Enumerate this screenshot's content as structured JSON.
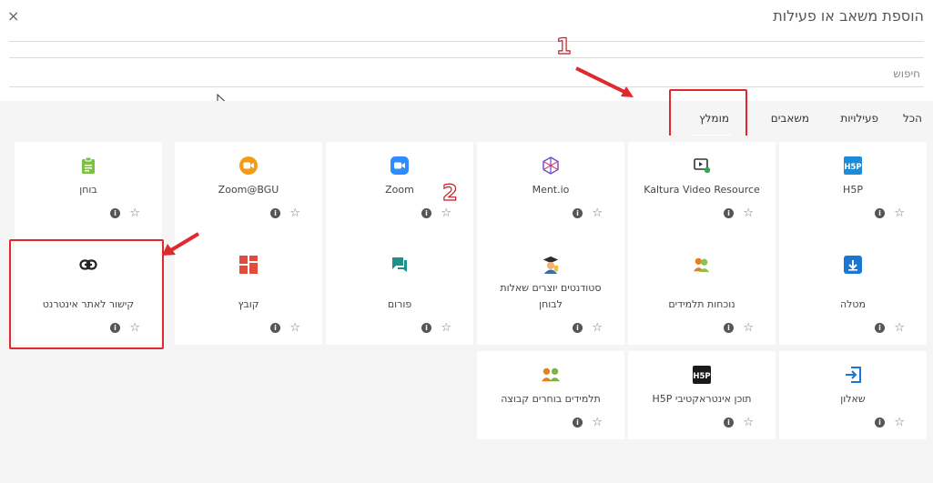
{
  "dialog": {
    "title": "הוספת משאב או פעילות",
    "close": "×",
    "search_placeholder": "חיפוש"
  },
  "tabs": [
    "הכל",
    "פעילויות",
    "משאבים",
    "מומלץ"
  ],
  "annotations": {
    "num1": "1",
    "num2": "2"
  },
  "cards": [
    {
      "label": "H5P",
      "icon": "h5p-icon",
      "info": "i",
      "star": "☆"
    },
    {
      "label": "Kaltura Video Resource",
      "icon": "kaltura-video-icon",
      "info": "i",
      "star": "☆"
    },
    {
      "label": "Ment.io",
      "icon": "mentio-icon",
      "info": "i",
      "star": "☆"
    },
    {
      "label": "Zoom",
      "icon": "zoom-icon",
      "info": "i",
      "star": "☆"
    },
    {
      "label": "Zoom@BGU",
      "icon": "zoom-bgu-icon",
      "info": "i",
      "star": "☆"
    },
    {
      "label": "בוחן",
      "icon": "quiz-icon",
      "info": "i",
      "star": "☆"
    },
    {
      "label": "מטלה",
      "icon": "assignment-icon",
      "info": "i",
      "star": "☆"
    },
    {
      "label": "נוכחות תלמידים",
      "icon": "attendance-icon",
      "info": "i",
      "star": "☆"
    },
    {
      "label": "סטודנטים יוצרים שאלות לבוחן",
      "icon": "student-quiz-icon",
      "info": "i",
      "star": "☆"
    },
    {
      "label": "פורום",
      "icon": "forum-icon",
      "info": "i",
      "star": "☆"
    },
    {
      "label": "קובץ",
      "icon": "file-icon",
      "info": "i",
      "star": "☆"
    },
    {
      "label": "קישור לאתר אינטרנט",
      "icon": "link-icon",
      "info": "i",
      "star": "☆"
    },
    {
      "label": "שאלון",
      "icon": "questionnaire-icon",
      "info": "i",
      "star": "☆"
    },
    {
      "label": "תוכן אינטראקטיבי H5P",
      "icon": "h5p-interactive-icon",
      "info": "i",
      "star": "☆"
    },
    {
      "label": "תלמידים בוחרים קבוצה",
      "icon": "group-choice-icon",
      "info": "i",
      "star": "☆"
    }
  ]
}
